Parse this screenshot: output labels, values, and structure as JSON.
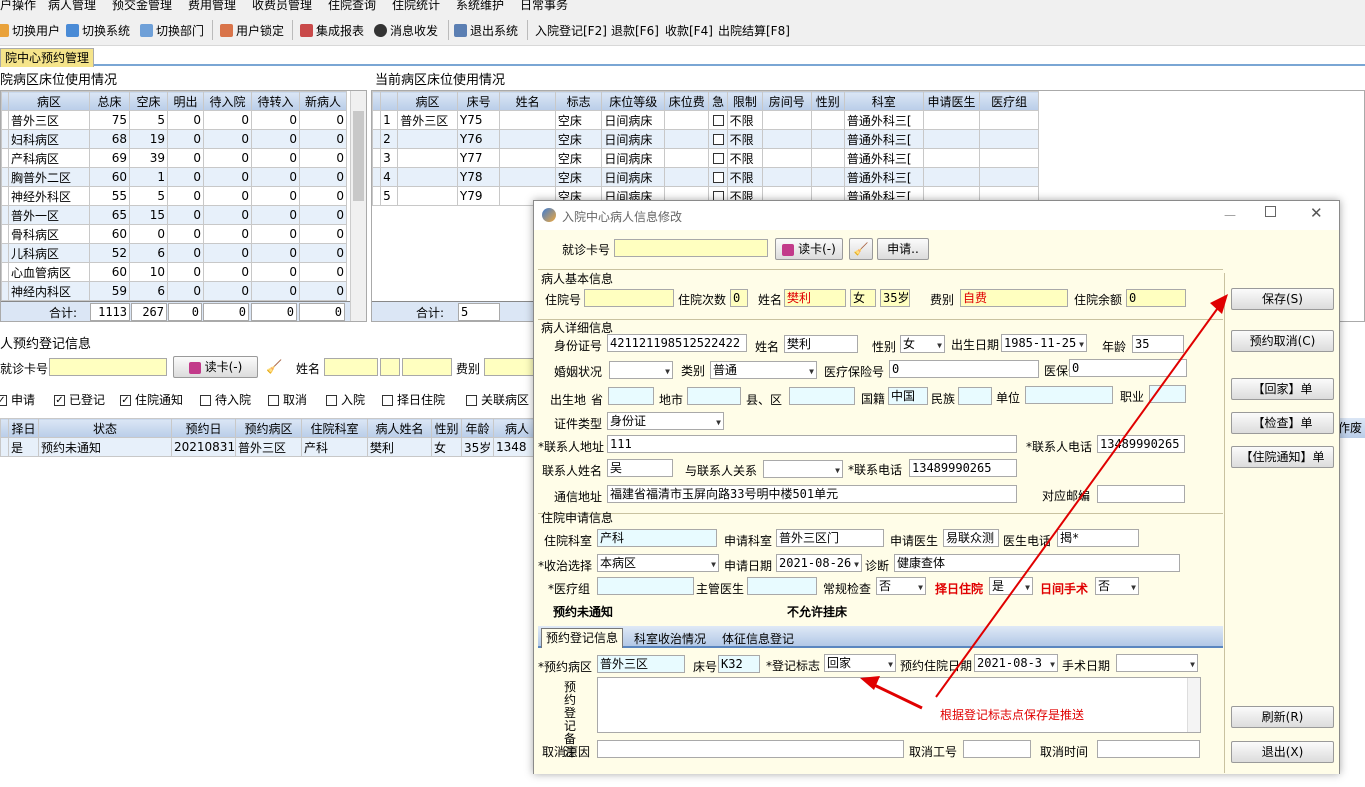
{
  "menu": [
    "户操作",
    "病人管理",
    "预交金管理",
    "费用管理",
    "收费员管理",
    "住院查询",
    "住院统计",
    "系统维护",
    "日常事务"
  ],
  "toolbar": {
    "switch_user": "切换用户",
    "switch_system": "切换系统",
    "switch_dept": "切换部门",
    "lock_user": "用户锁定",
    "report": "集成报表",
    "message": "消息收发",
    "exit": "退出系统",
    "admit": "入院登记[F2]",
    "refund": "退款[F6]",
    "charge": "收款[F4]",
    "discharge": "出院结算[F8]"
  },
  "tab": "院中心预约管理",
  "left_panel": {
    "title": "院病区床位使用情况",
    "headers": [
      "病区",
      "总床",
      "空床",
      "明出",
      "待入院",
      "待转入",
      "新病人"
    ],
    "rows": [
      [
        "普外三区",
        "75",
        "5",
        "0",
        "0",
        "0",
        "0"
      ],
      [
        "妇科病区",
        "68",
        "19",
        "0",
        "0",
        "0",
        "0"
      ],
      [
        "产科病区",
        "69",
        "39",
        "0",
        "0",
        "0",
        "0"
      ],
      [
        "胸普外二区",
        "60",
        "1",
        "0",
        "0",
        "0",
        "0"
      ],
      [
        "神经外科区",
        "55",
        "5",
        "0",
        "0",
        "0",
        "0"
      ],
      [
        "普外一区",
        "65",
        "15",
        "0",
        "0",
        "0",
        "0"
      ],
      [
        "骨科病区",
        "60",
        "0",
        "0",
        "0",
        "0",
        "0"
      ],
      [
        "儿科病区",
        "52",
        "6",
        "0",
        "0",
        "0",
        "0"
      ],
      [
        "心血管病区",
        "60",
        "10",
        "0",
        "0",
        "0",
        "0"
      ],
      [
        "神经内科区",
        "59",
        "6",
        "0",
        "0",
        "0",
        "0"
      ]
    ],
    "footer": [
      "合计:",
      "1113",
      "267",
      "0",
      "0",
      "0",
      "0"
    ]
  },
  "right_panel": {
    "title": "当前病区床位使用情况",
    "headers": [
      "",
      "病区",
      "床号",
      "姓名",
      "标志",
      "床位等级",
      "床位费",
      "急",
      "限制",
      "房间号",
      "性别",
      "科室",
      "申请医生",
      "医疗组"
    ],
    "rows": [
      [
        "1",
        "普外三区",
        "Y75",
        "",
        "空床",
        "日间病床",
        "",
        "",
        "不限",
        "",
        "",
        "普通外科三[",
        "",
        ""
      ],
      [
        "2",
        "",
        "Y76",
        "",
        "空床",
        "日间病床",
        "",
        "",
        "不限",
        "",
        "",
        "普通外科三[",
        "",
        ""
      ],
      [
        "3",
        "",
        "Y77",
        "",
        "空床",
        "日间病床",
        "",
        "",
        "不限",
        "",
        "",
        "普通外科三[",
        "",
        ""
      ],
      [
        "4",
        "",
        "Y78",
        "",
        "空床",
        "日间病床",
        "",
        "",
        "不限",
        "",
        "",
        "普通外科三[",
        "",
        ""
      ],
      [
        "5",
        "",
        "Y79",
        "",
        "空床",
        "日间病床",
        "",
        "",
        "不限",
        "",
        "",
        "普通外科三[",
        "",
        ""
      ]
    ],
    "footer_label": "合计:",
    "footer_value": "5"
  },
  "reg": {
    "title": "人预约登记信息",
    "card_label": "就诊卡号",
    "read_card": "读卡(-)",
    "name_label": "姓名",
    "fee_label": "费别",
    "filters": [
      {
        "label": "申请",
        "checked": true
      },
      {
        "label": "已登记",
        "checked": true
      },
      {
        "label": "住院通知",
        "checked": true
      },
      {
        "label": "待入院",
        "checked": false
      },
      {
        "label": "取消",
        "checked": false
      },
      {
        "label": "入院",
        "checked": false
      },
      {
        "label": "择日住院",
        "checked": false
      },
      {
        "label": "关联病区",
        "checked": false
      }
    ],
    "headers": [
      "择日",
      "状态",
      "预约日",
      "预约病区",
      "住院科室",
      "病人姓名",
      "性别",
      "年龄",
      "病人"
    ],
    "row": [
      "是",
      "预约未通知",
      "20210831",
      "普外三区",
      "产科",
      "樊利",
      "女",
      "35岁",
      "1348"
    ],
    "right_header": "作废"
  },
  "dialog": {
    "title": "入院中心病人信息修改",
    "card_label": "就诊卡号",
    "read_card": "读卡(-)",
    "apply": "申请..",
    "basic_section": "病人基本信息",
    "inpatient_no": "住院号",
    "times_label": "住院次数",
    "times": "0",
    "name_label": "姓名",
    "name": "樊利",
    "sex": "女",
    "age_str": "35岁",
    "fee_label": "费别",
    "fee": "自费",
    "balance_label": "住院余额",
    "balance": "0",
    "detail_section": "病人详细信息",
    "id_label": "身份证号",
    "id_no": "421121198512522422",
    "name2_label": "姓名",
    "name2": "樊利",
    "sex_label": "性别",
    "sex2": "女",
    "birth_label": "出生日期",
    "birth": "1985-11-25",
    "age_label": "年龄",
    "age": "35",
    "marital_label": "婚姻状况",
    "type_label": "类别",
    "type": "普通",
    "insure_label": "医疗保险号",
    "insure": "0",
    "insure_card_label": "医保卡号",
    "insure_card": "0",
    "birthplace_label": "出生地",
    "province": "省",
    "city": "地市",
    "county": "县、区",
    "nation_label": "国籍",
    "nation": "中国",
    "ethnic_label": "民族",
    "work_label": "单位",
    "job_label": "职业",
    "cert_label": "证件类型",
    "cert": "身份证",
    "addr_label": "*联系人地址",
    "addr": "111",
    "phone_label": "*联系人电话",
    "phone": "13489990265",
    "contact_label": "联系人姓名",
    "contact": "吴",
    "relation_label": "与联系人关系",
    "contact_phone_label": "*联系电话",
    "contact_phone": "13489990265",
    "mail_label": "通信地址",
    "mail": "福建省福清市玉屏向路33号明中楼501单元",
    "zip_label": "对应邮编",
    "apply_section": "住院申请信息",
    "dept_label": "住院科室",
    "dept": "产科",
    "apply_dept_label": "申请科室",
    "apply_dept": "普外三区门",
    "doctor_label": "申请医生",
    "doctor": "易联众测",
    "doctor_phone_label": "医生电话",
    "doctor_phone": "揭*",
    "ward_sel_label": "*收治选择",
    "ward_sel": "本病区",
    "apply_date_label": "申请日期",
    "apply_date": "2021-08-26",
    "diag_label": "诊断",
    "diag": "健康查体",
    "group_label": "*医疗组",
    "main_doc_label": "主管医生",
    "routine_label": "常规检查",
    "routine": "否",
    "schedule_label": "择日住院",
    "schedule": "是",
    "day_op_label": "日间手术",
    "day_op": "否",
    "status1": "预约未通知",
    "status2": "不允许挂床",
    "tabs": [
      "预约登记信息",
      "科室收治情况",
      "体征信息登记"
    ],
    "res_ward_label": "*预约病区",
    "res_ward": "普外三区",
    "bed_label": "床号",
    "bed": "K32",
    "mark_label": "*登记标志",
    "mark": "回家",
    "res_date_label": "预约住院日期",
    "res_date": "2021-08-3",
    "op_date_label": "手术日期",
    "remark_label": "预约登记备注",
    "cancel_reason_label": "取消原因",
    "cancel_no_label": "取消工号",
    "cancel_time_label": "取消时间",
    "annotation": "根据登记标志点保存是推送",
    "buttons": {
      "save": "保存(S)",
      "cancel_res": "预约取消(C)",
      "home": "【回家】单",
      "check": "【检查】单",
      "notice": "【住院通知】单",
      "refresh": "刷新(R)",
      "exit": "退出(X)"
    },
    "annotation_color": "#e00000"
  }
}
